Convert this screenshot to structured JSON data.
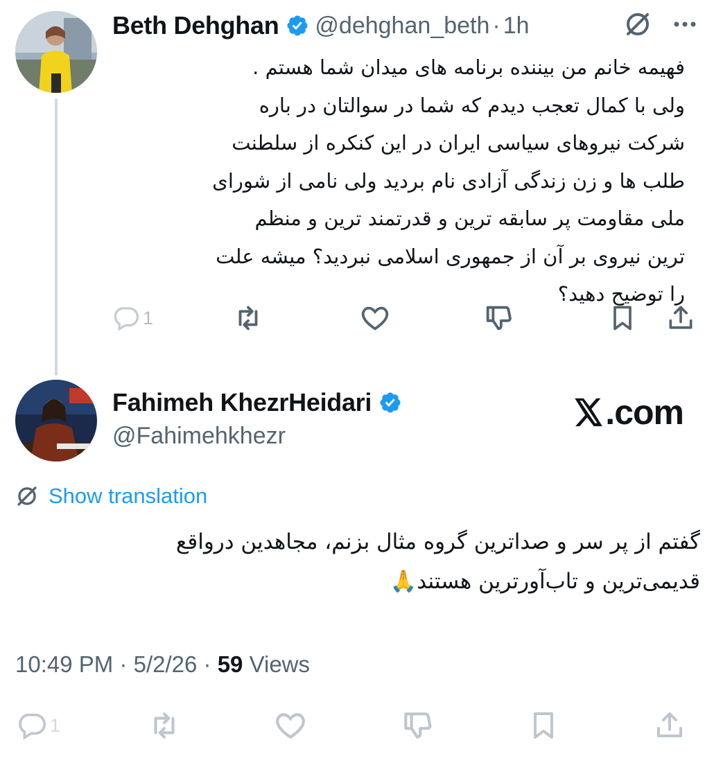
{
  "reply": {
    "display_name": "Beth Dehghan",
    "handle": "@dehghan_beth",
    "separator": "·",
    "time": "1h",
    "body_lines": [
      "فهیمه خانم من بیننده برنامه های میدان شما هستم .",
      "ولی با کمال تعجب دیدم که شما در سوالتان در باره",
      "شرکت نیروهای سیاسی ایران در این کنکره از سلطنت",
      "طلب ها و زن زندگی آزادی نام بردید ولی نامی از شورای",
      "ملی مقاومت پر سابقه ترین و قدرتمند ترین و منظم",
      "ترین نیروی بر آن از جمهوری اسلامی نبردید؟ میشه علت",
      "را توضیح دهید؟"
    ],
    "reply_count": "1"
  },
  "main": {
    "display_name": "Fahimeh KhezrHeidari",
    "handle": "@Fahimehkhezr",
    "brand": ".com",
    "show_translation": "Show translation",
    "body_lines": [
      "گفتم از پر سر و صداترین گروه مثال بزنم، مجاهدین درواقع",
      "قدیمی‌ترین و تاب‌آورترین هستند🙏"
    ],
    "time": "10:49 PM",
    "separator": "·",
    "date": "5/2/26",
    "views_count": "59",
    "views_label": "Views",
    "reply_count": "1"
  },
  "colors": {
    "accent": "#1d9bf0",
    "text": "#0f1419",
    "secondary": "#536471",
    "thread_line": "#cfd9de"
  },
  "icons": [
    "verified-badge-icon",
    "translate-icon",
    "more-icon",
    "reply-icon",
    "retweet-icon",
    "like-icon",
    "dislike-icon",
    "bookmark-icon",
    "share-icon",
    "x-logo-icon"
  ]
}
